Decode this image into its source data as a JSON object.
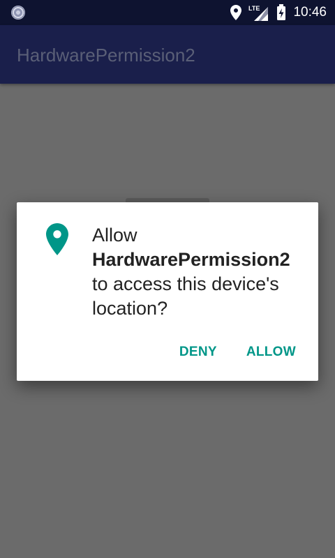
{
  "status_bar": {
    "time": "10:46",
    "network": "LTE",
    "icons": [
      "notification-icon",
      "location-icon",
      "signal-icon",
      "battery-charging-icon"
    ]
  },
  "app_bar": {
    "title": "HardwarePermission2"
  },
  "dialog": {
    "line_prefix": "Allow",
    "app_name": "HardwarePermission2",
    "line_suffix": "to access this device's location?",
    "icon": "location-pin-icon",
    "deny_label": "DENY",
    "allow_label": "ALLOW"
  },
  "colors": {
    "status_bar": "#0e1330",
    "app_bar": "#1a1f4b",
    "scrim": "#6b6b6b",
    "accent": "#009688"
  }
}
